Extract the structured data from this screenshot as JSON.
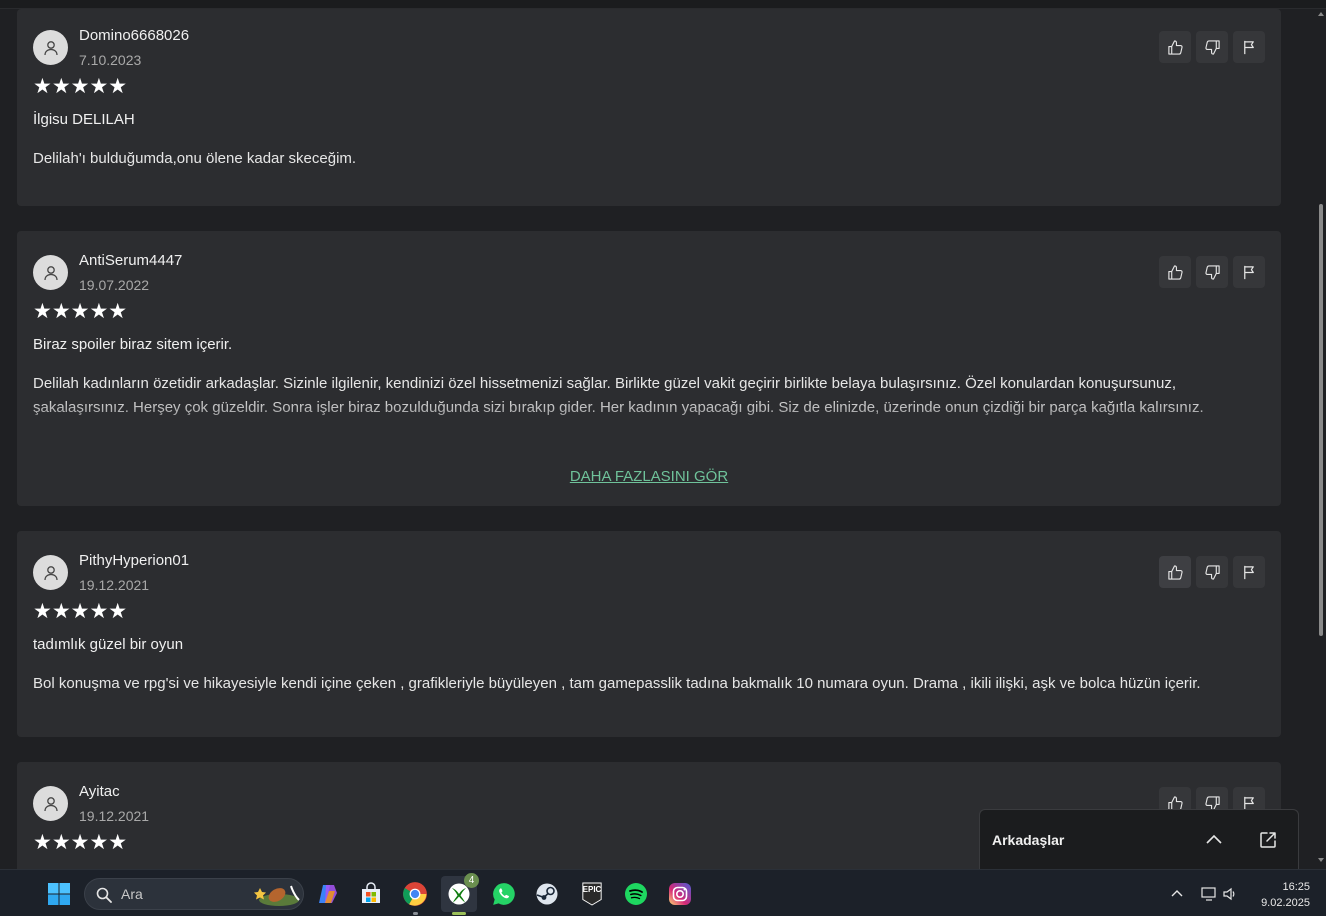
{
  "reviews": [
    {
      "username": "Domino6668026",
      "date": "7.10.2023",
      "stars": "★★★★★",
      "title": "İlgisu DELILAH",
      "body": "Delilah'ı bulduğumda,onu ölene kadar skeceğim."
    },
    {
      "username": "AntiSerum4447",
      "date": "19.07.2022",
      "stars": "★★★★★",
      "title": "Biraz spoiler biraz sitem içerir.",
      "body": "Delilah kadınların özetidir arkadaşlar. Sizinle ilgilenir, kendinizi özel hissetmenizi sağlar. Birlikte güzel vakit geçirir birlikte belaya bulaşırsınız. Özel konulardan konuşursunuz, şakalaşırsınız. Herşey çok güzeldir. Sonra işler biraz bozulduğunda sizi bırakıp gider. Her kadının yapacağı gibi. Siz de elinizde, üzerinde onun çizdiği bir parça kağıtla kalırsınız.",
      "more_label": "DAHA FAZLASINI GÖR"
    },
    {
      "username": "PithyHyperion01",
      "date": "19.12.2021",
      "stars": "★★★★★",
      "title": "tadımlık güzel bir oyun",
      "body": "Bol konuşma ve rpg'si ve hikayesiyle kendi içine çeken , grafikleriyle büyüleyen , tam gamepasslik tadına bakmalık 10 numara oyun. Drama , ikili ilişki, aşk ve bolca hüzün içerir."
    },
    {
      "username": "Ayitac",
      "date": "19.12.2021",
      "stars": "★★★★★"
    }
  ],
  "friends_panel": {
    "title": "Arkadaşlar"
  },
  "taskbar": {
    "search_placeholder": "Ara",
    "xbox_badge": "4",
    "time": "16:25",
    "date": "9.02.2025",
    "epic_label": "EPIC"
  }
}
